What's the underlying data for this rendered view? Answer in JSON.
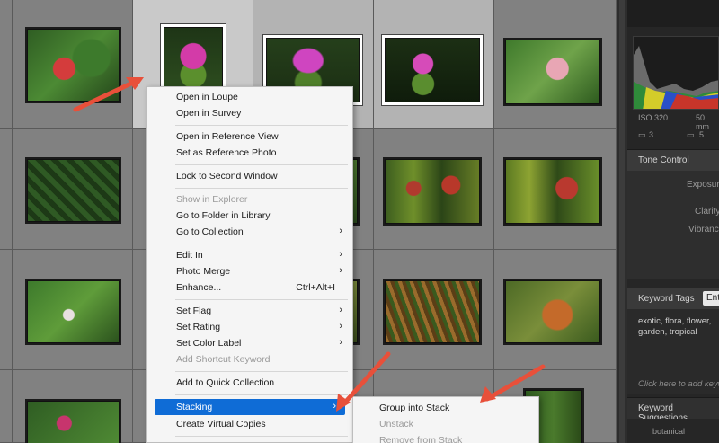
{
  "context_menu": {
    "items": [
      {
        "label": "Open in Loupe"
      },
      {
        "label": "Open in Survey"
      },
      {
        "label": "Open in Reference View"
      },
      {
        "label": "Set as Reference Photo"
      },
      {
        "label": "Lock to Second Window"
      },
      {
        "label": "Show in Explorer"
      },
      {
        "label": "Go to Folder in Library"
      },
      {
        "label": "Go to Collection"
      },
      {
        "label": "Edit In"
      },
      {
        "label": "Photo Merge"
      },
      {
        "label": "Enhance..."
      },
      {
        "label": "Set Flag"
      },
      {
        "label": "Set Rating"
      },
      {
        "label": "Set Color Label"
      },
      {
        "label": "Add Shortcut Keyword"
      },
      {
        "label": "Add to Quick Collection"
      },
      {
        "label": "Stacking"
      },
      {
        "label": "Create Virtual Copies"
      }
    ],
    "enhance_shortcut": "Ctrl+Alt+I"
  },
  "submenu": {
    "items": [
      {
        "label": "Group into Stack"
      },
      {
        "label": "Unstack"
      },
      {
        "label": "Remove from Stack"
      }
    ]
  },
  "right_panel": {
    "iso": "ISO 320",
    "focal": "50 mm",
    "count_a": "3",
    "count_b": "5",
    "tone_control": "Tone Control",
    "exposure": "Exposure",
    "clarity": "Clarity",
    "vibrance": "Vibrance",
    "keyword_tags": "Keyword Tags",
    "keyword_tags_btn": "Ent",
    "keywords_text": "exotic, flora, flower, garden, tropical",
    "keyword_placeholder": "Click here to add keywords",
    "keyword_suggestions": "Keyword Suggestions",
    "suggestion_1": "botanical"
  },
  "colors": {
    "menu_highlight": "#0f6cd6",
    "arrow": "#e8503a",
    "grid_cell": "#818181",
    "selected_cell": "#b3b3b3"
  }
}
